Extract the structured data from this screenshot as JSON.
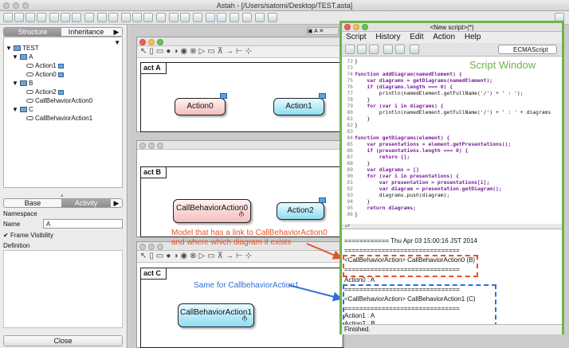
{
  "window": {
    "title": "Astah - [/Users/satomi/Desktop/TEST.asta]"
  },
  "left_panel": {
    "tabs": [
      "Structure",
      "Inheritance"
    ],
    "tree": [
      {
        "label": "TEST",
        "kind": "package"
      },
      {
        "label": "A",
        "kind": "package"
      },
      {
        "label": "Action1",
        "kind": "action"
      },
      {
        "label": "Action0",
        "kind": "action"
      },
      {
        "label": "B",
        "kind": "package"
      },
      {
        "label": "Action2",
        "kind": "action"
      },
      {
        "label": "CallBehaviorAction0",
        "kind": "call-action"
      },
      {
        "label": "C",
        "kind": "package"
      },
      {
        "label": "CallBehaviorAction1",
        "kind": "call-action"
      }
    ],
    "prop_tabs": [
      "Base",
      "Activity"
    ],
    "namespace_label": "Namespace",
    "name_label": "Name",
    "name_value": "A",
    "frame_visibility_label": "Frame Visibility",
    "definition_label": "Definition",
    "close_label": "Close"
  },
  "diagrams": [
    {
      "label": "act A",
      "nodes": [
        "Action0",
        "Action1"
      ]
    },
    {
      "label": "act B",
      "nodes": [
        "CallBehaviorAction0",
        "Action2"
      ]
    },
    {
      "label": "act C",
      "nodes": [
        "CallBehaviorAction1"
      ]
    }
  ],
  "annotations": {
    "model_link": "Model that has a link to CallBehaviorAction0\nand where which diagram it exists",
    "same_for": "Same for CallbehaviorAction1",
    "script_window": "Script Window"
  },
  "script_window": {
    "title": "<New script>(*)",
    "menu": [
      "Script",
      "History",
      "Edit",
      "Action",
      "Help"
    ],
    "engine": "ECMAScript",
    "code": [
      {
        "n": "72",
        "t": "}"
      },
      {
        "n": "73",
        "t": ""
      },
      {
        "n": "74",
        "t": "function addDiagram(namedElement) {"
      },
      {
        "n": "75",
        "t": "    var diagrams = getDiagrams(namedElement);"
      },
      {
        "n": "76",
        "t": "    if (diagrams.length === 0) {"
      },
      {
        "n": "77",
        "t": "        println(namedElement.getFullName('/') + ' : ');"
      },
      {
        "n": "78",
        "t": "    }"
      },
      {
        "n": "79",
        "t": "    for (var i in diagrams) {"
      },
      {
        "n": "80",
        "t": "        println(namedElement.getFullName('/') + ' : ' + diagrams"
      },
      {
        "n": "81",
        "t": "    }"
      },
      {
        "n": "82",
        "t": "}"
      },
      {
        "n": "83",
        "t": ""
      },
      {
        "n": "84",
        "t": "function getDiagrams(element) {"
      },
      {
        "n": "85",
        "t": "    var presentations = element.getPresentations();"
      },
      {
        "n": "86",
        "t": "    if (presentations.length === 0) {"
      },
      {
        "n": "87",
        "t": "        return [];"
      },
      {
        "n": "88",
        "t": "    }"
      },
      {
        "n": "89",
        "t": "    var diagrams = []"
      },
      {
        "n": "90",
        "t": "    for (var i in presentations) {"
      },
      {
        "n": "91",
        "t": "        var presentation = presentations[i];"
      },
      {
        "n": "92",
        "t": "        var diagram = presentation.getDiagram();"
      },
      {
        "n": "93",
        "t": "        diagrams.push(diagram);"
      },
      {
        "n": "94",
        "t": "    }"
      },
      {
        "n": "95",
        "t": "    return diagrams;"
      },
      {
        "n": "96",
        "t": "}"
      }
    ],
    "output": [
      "============ Thu Apr 03 15:00:16 JST 2014",
      "===============================",
      "<CallBehaviorAction> CallBehaviorAction0 (B)",
      "===============================",
      "Action0 : A",
      "===============================",
      "<CallBehaviorAction> CallBehaviorAction1 (C)",
      "===============================",
      "Action1 : A",
      "Action2 : B"
    ],
    "status": "Finished."
  },
  "colors": {
    "script_border": "#6fb44a",
    "red_annotation": "#e8502a",
    "blue_annotation": "#2f6fd6"
  }
}
